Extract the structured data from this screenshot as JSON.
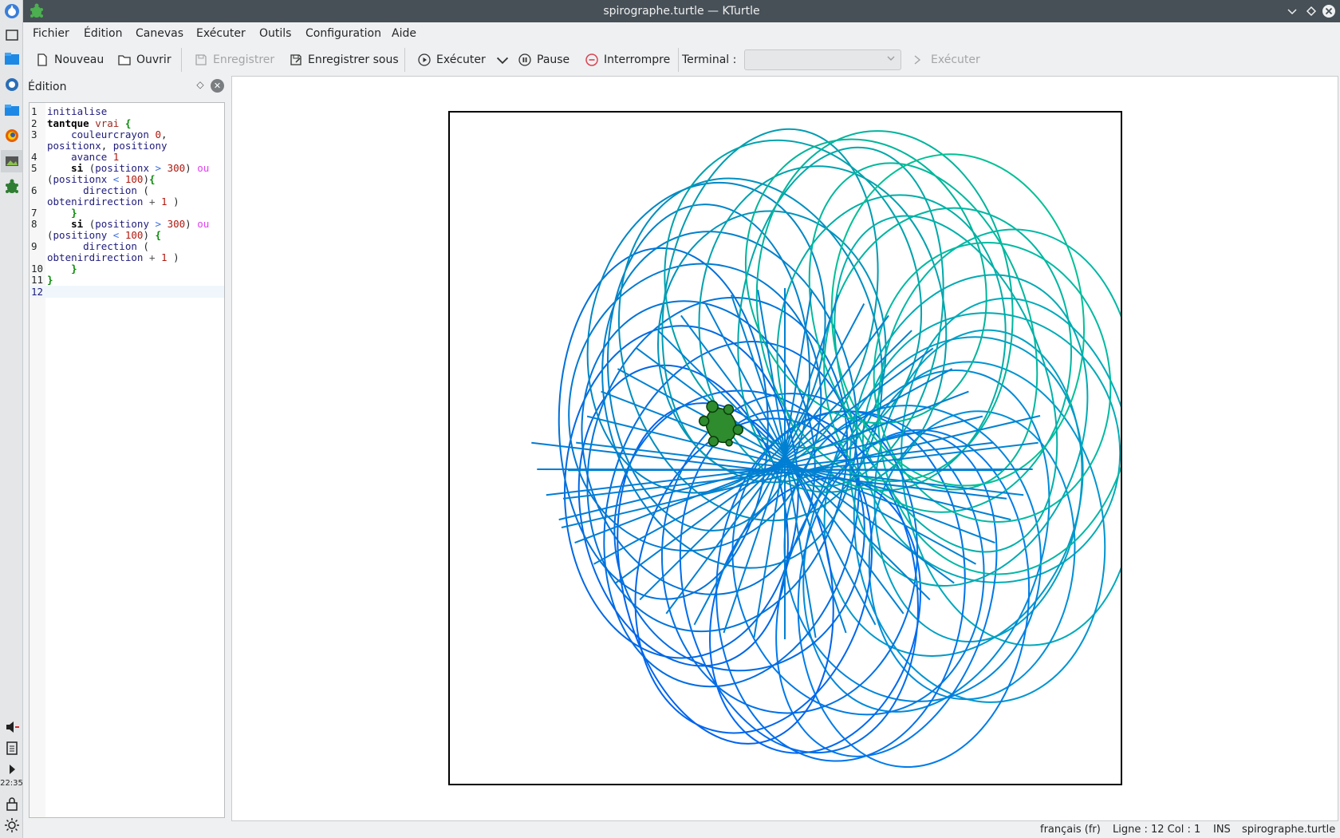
{
  "window": {
    "title": "spirographe.turtle — KTurtle"
  },
  "menubar": {
    "items": [
      "Fichier",
      "Édition",
      "Canevas",
      "Exécuter",
      "Outils",
      "Configuration",
      "Aide"
    ]
  },
  "toolbar": {
    "new_label": "Nouveau",
    "open_label": "Ouvrir",
    "save_label": "Enregistrer",
    "save_as_label": "Enregistrer sous",
    "run_label": "Exécuter",
    "pause_label": "Pause",
    "abort_label": "Interrompre",
    "terminal_label": "Terminal :",
    "terminal_value": "",
    "terminal_run_label": "Exécuter"
  },
  "editor": {
    "dock_title": "Édition",
    "current_line": 12
  },
  "taskbar": {
    "clock": "22:35"
  },
  "statusbar": {
    "language": "français (fr)",
    "position": "Ligne : 12 Col : 1",
    "mode": "INS",
    "filename": "spirographe.turtle"
  },
  "canvas": {
    "turtle_color": "#2e8b2e"
  }
}
